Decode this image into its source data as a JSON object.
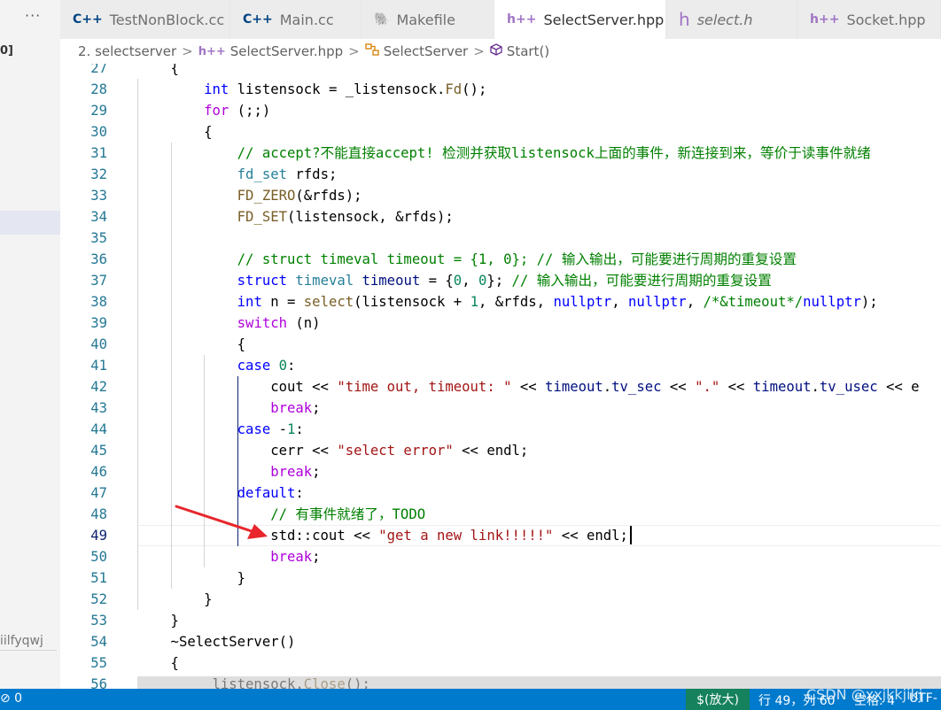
{
  "sidebar": {
    "dots": "···",
    "frag_top": "0]",
    "frag_bottom": "iilfyqwj"
  },
  "tabs": [
    {
      "icon": "C++",
      "label": "TestNonBlock.cc",
      "modified": false
    },
    {
      "icon": "C++",
      "label": "Main.cc",
      "modified": false
    },
    {
      "icon": "🐘",
      "label": "Makefile",
      "modified": false
    },
    {
      "icon": "h++",
      "label": "SelectServer.hpp",
      "modified": true,
      "dot": "●"
    },
    {
      "icon": "h",
      "label": "select.h",
      "modified": false
    },
    {
      "icon": "h++",
      "label": "Socket.hpp",
      "modified": false
    }
  ],
  "breadcrumb": {
    "folder": "2. selectserver",
    "file_icon": "h++",
    "file": "SelectServer.hpp",
    "class_icon": "class-icon",
    "class": "SelectServer",
    "method_icon": "method-icon",
    "method": "Start()",
    "sep": ">"
  },
  "editor": {
    "cursor_line": 49,
    "lines": [
      {
        "n": "27",
        "code": "    {"
      },
      {
        "n": "28",
        "code": "        int listensock = _listensock.Fd();"
      },
      {
        "n": "29",
        "code": "        for (;;)"
      },
      {
        "n": "30",
        "code": "        {"
      },
      {
        "n": "31",
        "code": "            // accept?不能直接accept! 检测并获取listensock上面的事件，新连接到来，等价于读事件就绪"
      },
      {
        "n": "32",
        "code": "            fd_set rfds;"
      },
      {
        "n": "33",
        "code": "            FD_ZERO(&rfds);"
      },
      {
        "n": "34",
        "code": "            FD_SET(listensock, &rfds);"
      },
      {
        "n": "35",
        "code": ""
      },
      {
        "n": "36",
        "code": "            // struct timeval timeout = {1, 0}; // 输入输出，可能要进行周期的重复设置"
      },
      {
        "n": "37",
        "code": "            struct timeval timeout = {0, 0}; // 输入输出，可能要进行周期的重复设置"
      },
      {
        "n": "38",
        "code": "            int n = select(listensock + 1, &rfds, nullptr, nullptr, /*&timeout*/nullptr);"
      },
      {
        "n": "39",
        "code": "            switch (n)"
      },
      {
        "n": "40",
        "code": "            {"
      },
      {
        "n": "41",
        "code": "            case 0:"
      },
      {
        "n": "42",
        "code": "                cout << \"time out, timeout: \" << timeout.tv_sec << \".\" << timeout.tv_usec << e"
      },
      {
        "n": "43",
        "code": "                break;"
      },
      {
        "n": "44",
        "code": "            case -1:"
      },
      {
        "n": "45",
        "code": "                cerr << \"select error\" << endl;"
      },
      {
        "n": "46",
        "code": "                break;"
      },
      {
        "n": "47",
        "code": "            default:"
      },
      {
        "n": "48",
        "code": "                // 有事件就绪了，TODO"
      },
      {
        "n": "49",
        "code": "                std::cout << \"get a new link!!!!!\" << endl;"
      },
      {
        "n": "50",
        "code": "                break;"
      },
      {
        "n": "51",
        "code": "            }"
      },
      {
        "n": "52",
        "code": "        }"
      },
      {
        "n": "53",
        "code": "    }"
      },
      {
        "n": "54",
        "code": "    ~SelectServer()"
      },
      {
        "n": "55",
        "code": "    {"
      },
      {
        "n": "56",
        "code": "        _listensock.Close();"
      }
    ]
  },
  "status": {
    "left": "⊘ 0",
    "zoom": "$(放大)",
    "position": "行 49，列 60",
    "indent": "空格: 4",
    "encoding": "UTF-",
    "watermark": "CSDN @xxjkkjikj"
  },
  "colors": {
    "status_bg": "#007acc",
    "zoom_bg": "#16825d",
    "arrow": "#e8262b"
  }
}
